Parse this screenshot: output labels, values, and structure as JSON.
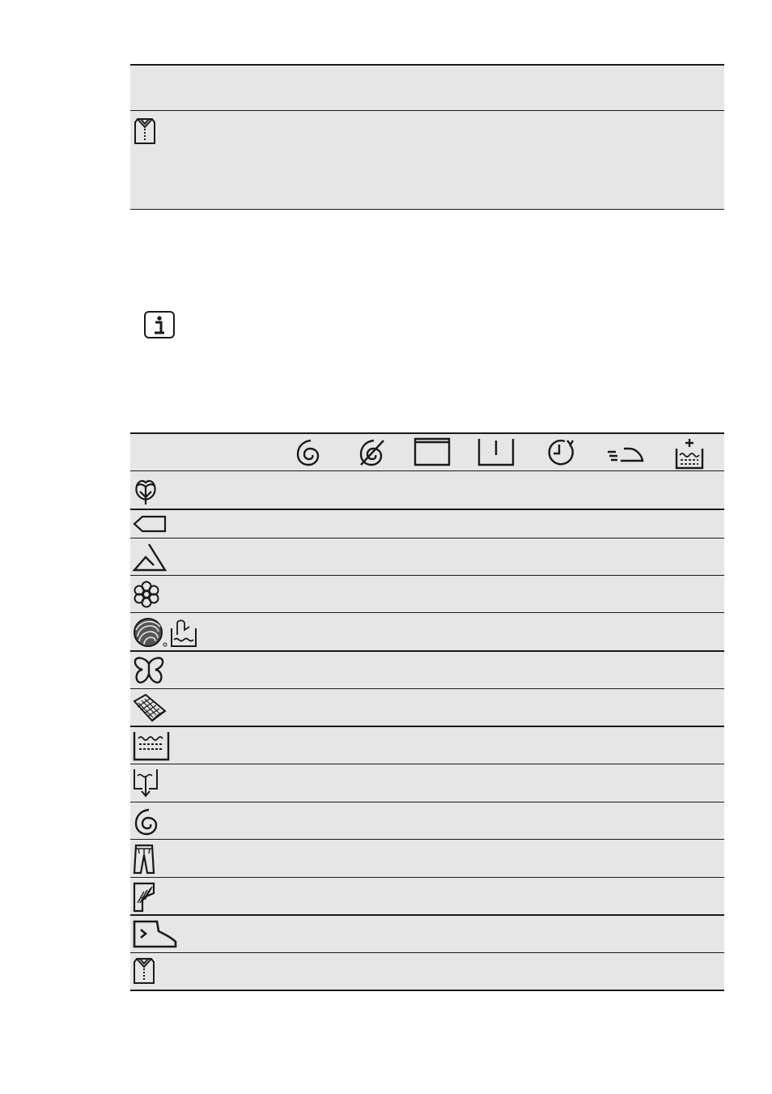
{
  "top_table": {
    "row_icon": "shirt-icon"
  },
  "info_note": {
    "icon": "info-icon"
  },
  "options_table": {
    "header_icons": [
      "spin-icon",
      "no-spin-icon",
      "rinse-hold-icon",
      "night-cycle-icon",
      "time-save-icon",
      "easy-iron-icon",
      "extra-rinse-icon"
    ],
    "program_icons": [
      "cotton-icon",
      "synthetics-icon",
      "delicates-icon",
      "mixed-flower-icon",
      "wool-handwash-icon",
      "silk-butterfly-icon",
      "curtains-icon",
      "rinse-icon",
      "drain-icon",
      "spin-icon",
      "denim-icon",
      "duvet-icon",
      "sportswear-shoe-icon",
      "shirts-icon"
    ]
  }
}
